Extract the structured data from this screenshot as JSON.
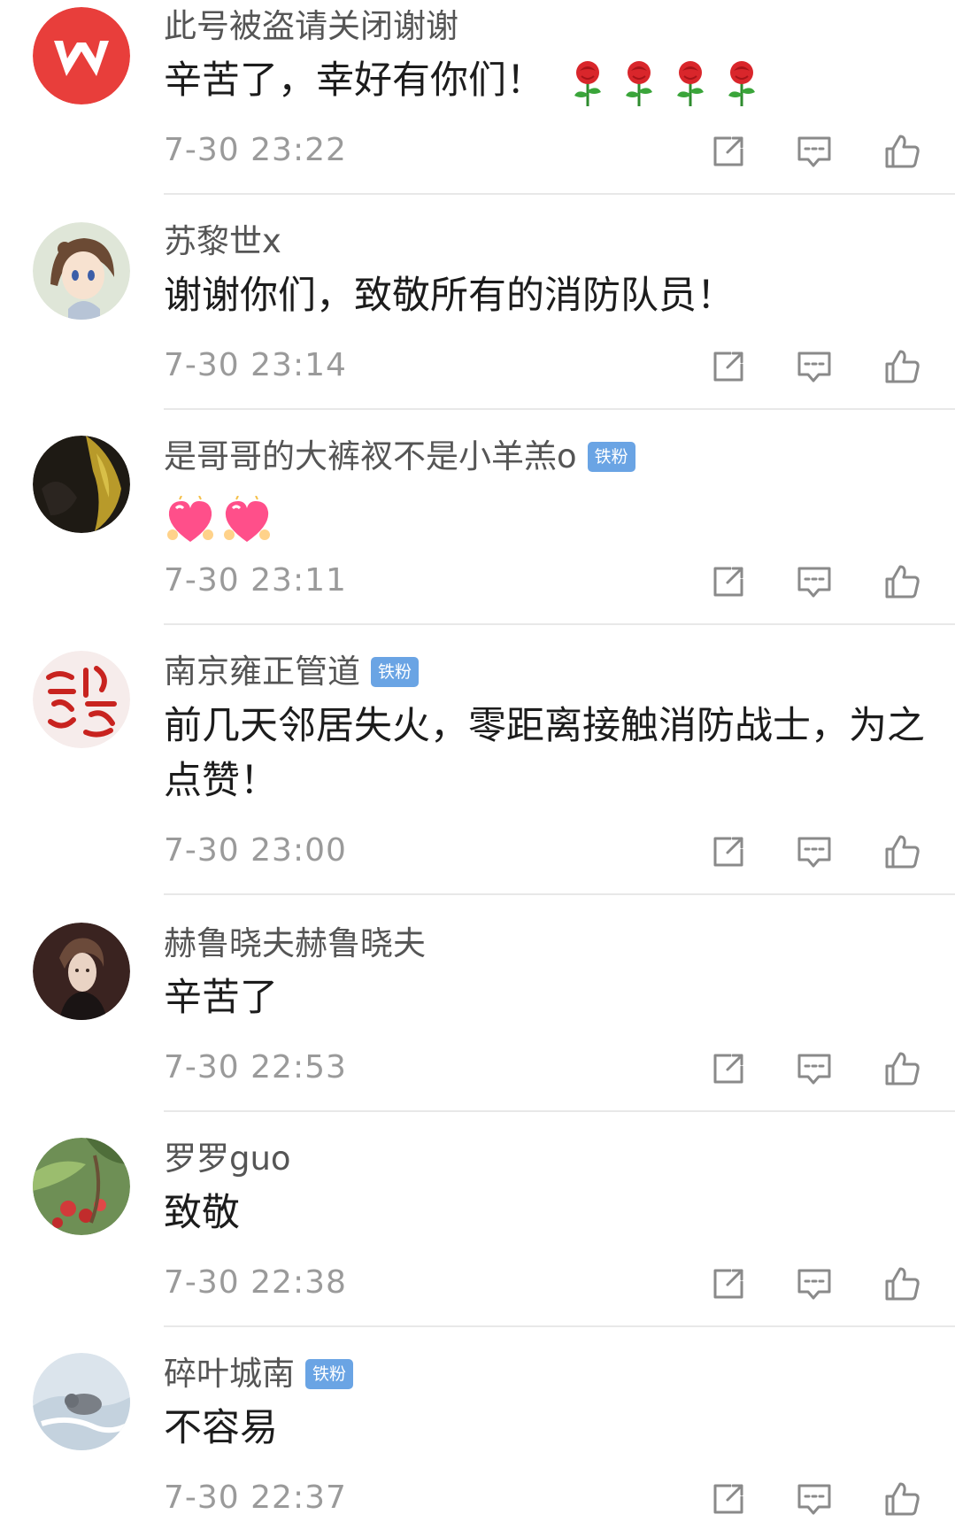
{
  "badge_label": "铁粉",
  "comments": [
    {
      "username": "此号被盗请关闭谢谢",
      "badge": false,
      "content": "辛苦了，幸好有你们！",
      "emoji": "rose-emoji",
      "emoji_count": 4,
      "time": "7-30 23:22",
      "avatar_icon": "wps-logo-avatar"
    },
    {
      "username": "苏黎世x",
      "badge": false,
      "content": "谢谢你们，致敬所有的消防队员！",
      "time": "7-30 23:14",
      "avatar_icon": "anime-girl-avatar"
    },
    {
      "username": "是哥哥的大裤衩不是小羊羔o",
      "badge": true,
      "content": "",
      "emoji": "heart-emoji",
      "emoji_count": 2,
      "time": "7-30 23:11",
      "avatar_icon": "dark-photo-avatar"
    },
    {
      "username": "南京雍正管道",
      "badge": true,
      "content": "前几天邻居失火，零距离接触消防战士，为之点赞！",
      "time": "7-30 23:00",
      "avatar_icon": "red-seal-avatar"
    },
    {
      "username": "赫鲁晓夫赫鲁晓夫",
      "badge": false,
      "content": "辛苦了",
      "time": "7-30 22:53",
      "avatar_icon": "portrait-avatar"
    },
    {
      "username": "罗罗guo",
      "badge": false,
      "content": "致敬",
      "time": "7-30 22:38",
      "avatar_icon": "strawberry-avatar"
    },
    {
      "username": "碎叶城南",
      "badge": true,
      "content": "不容易",
      "time": "7-30 22:37",
      "avatar_icon": "snow-animal-avatar"
    }
  ],
  "action_icons": [
    "share-icon",
    "comment-icon",
    "like-icon"
  ],
  "colors": {
    "username": "#555555",
    "content": "#1c1c1c",
    "time": "#9a9a9a",
    "badge": "#6aa4e4",
    "icon": "#8a8a8a",
    "divider": "#e8e8e8"
  }
}
